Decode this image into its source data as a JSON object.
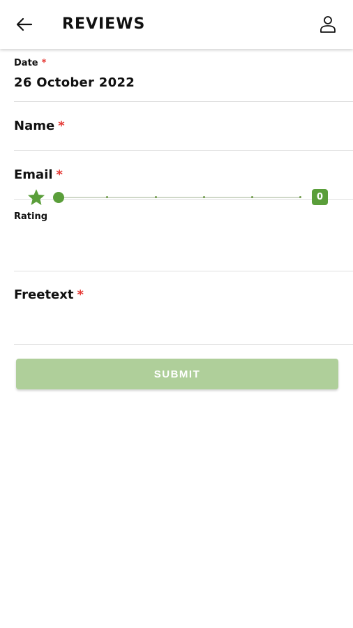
{
  "header": {
    "back_icon": "arrow-left-icon",
    "title": "REVIEWS",
    "profile_icon": "user-icon"
  },
  "form": {
    "date": {
      "label": "Date",
      "required_mark": "*",
      "value": "26 October 2022"
    },
    "name": {
      "label": "Name",
      "required_mark": "*",
      "value": ""
    },
    "email": {
      "label": "Email",
      "required_mark": "*",
      "value": ""
    },
    "rating": {
      "label": "Rating",
      "value": "0",
      "icon": "star-icon",
      "min": 0,
      "max": 5,
      "current": 0
    },
    "freetext": {
      "label": "Freetext",
      "required_mark": "*",
      "value": ""
    }
  },
  "submit": {
    "label": "SUBMIT"
  },
  "colors": {
    "accent": "#5a9e3a",
    "required": "#e53935",
    "submit_disabled": "#afcf9a"
  }
}
